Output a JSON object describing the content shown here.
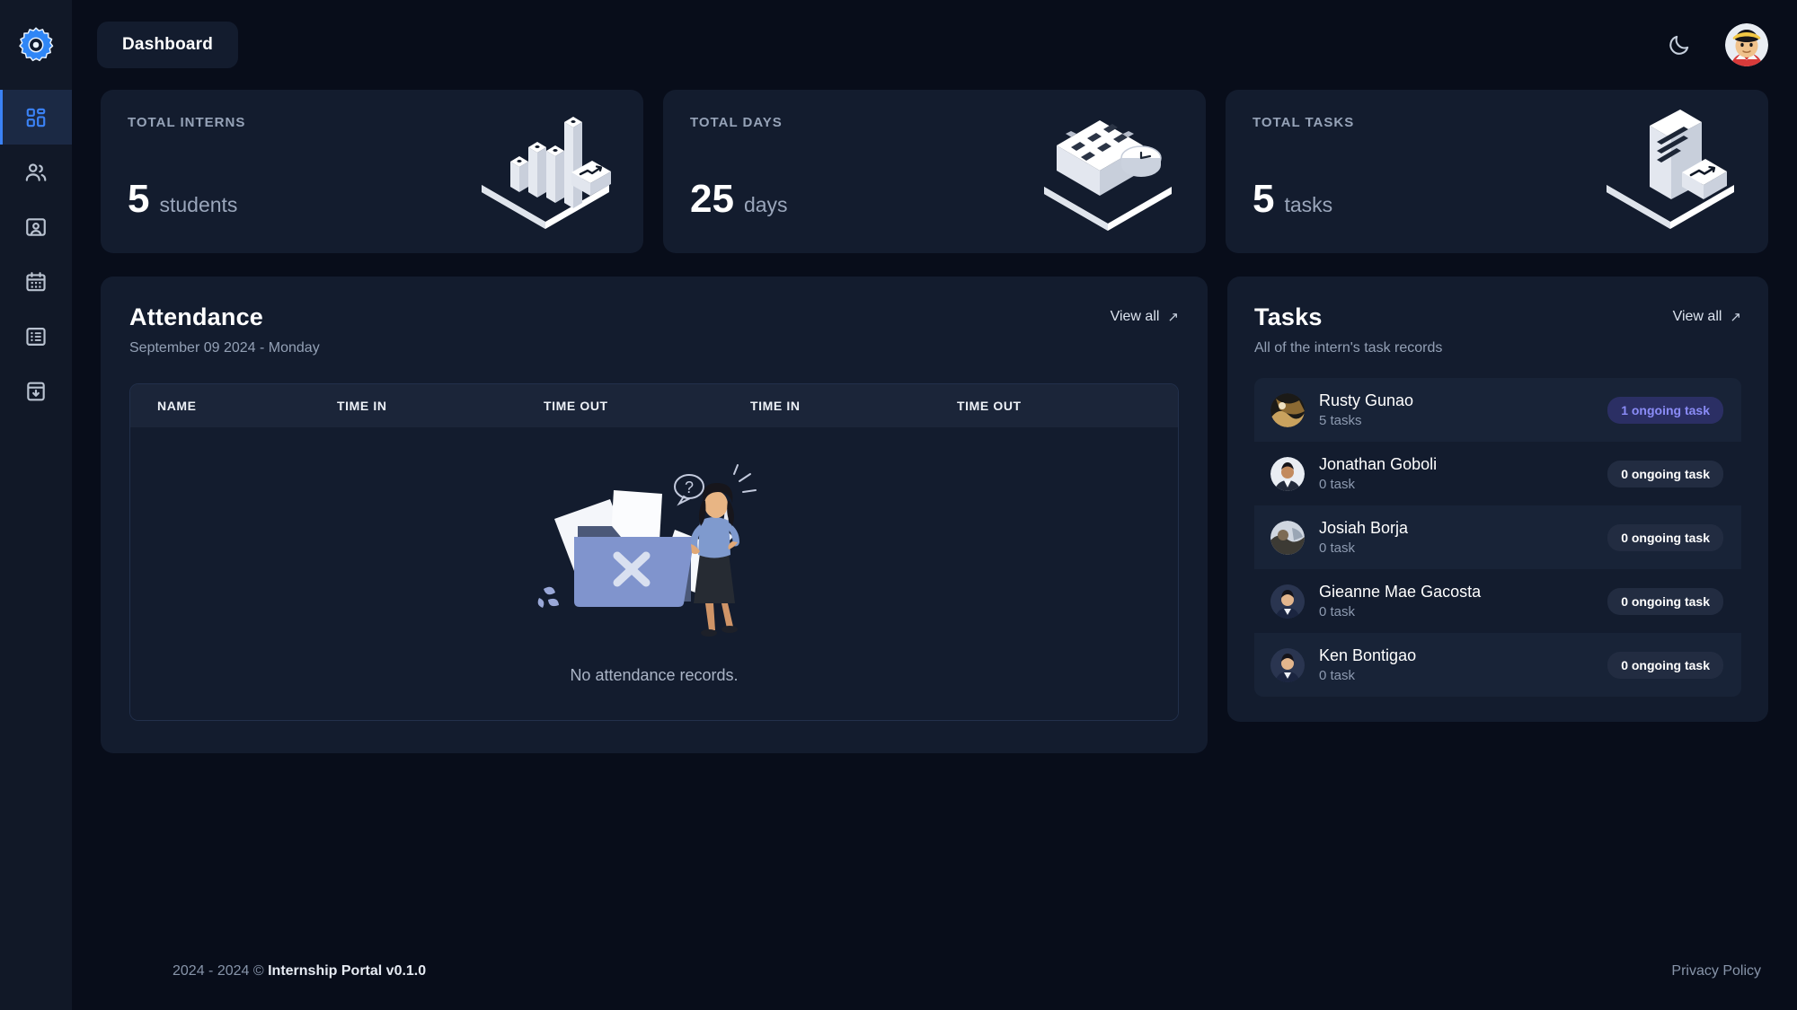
{
  "sidebar": {
    "logo_icon": "gear-icon",
    "items": [
      {
        "icon": "dashboard-grid-icon",
        "name": "dashboard",
        "active": true
      },
      {
        "icon": "users-icon",
        "name": "interns",
        "active": false
      },
      {
        "icon": "id-badge-icon",
        "name": "profiles",
        "active": false
      },
      {
        "icon": "calendar-icon",
        "name": "attendance",
        "active": false
      },
      {
        "icon": "list-icon",
        "name": "tasks",
        "active": false
      },
      {
        "icon": "archive-download-icon",
        "name": "reports",
        "active": false
      }
    ]
  },
  "topbar": {
    "page_title": "Dashboard",
    "theme_toggle_icon": "moon-icon",
    "avatar_icon": "user-avatar"
  },
  "stats": [
    {
      "label": "TOTAL INTERNS",
      "value": "5",
      "unit": "students",
      "art": "bar-chart-3d-icon"
    },
    {
      "label": "TOTAL DAYS",
      "value": "25",
      "unit": "days",
      "art": "calendar-clock-3d-icon"
    },
    {
      "label": "TOTAL TASKS",
      "value": "5",
      "unit": "tasks",
      "art": "document-3d-icon"
    }
  ],
  "attendance": {
    "title": "Attendance",
    "date": "September 09 2024 - Monday",
    "view_all": "View all",
    "columns": [
      "NAME",
      "TIME IN",
      "TIME OUT",
      "TIME IN",
      "TIME OUT"
    ],
    "rows": [],
    "empty_text": "No attendance records."
  },
  "tasks": {
    "title": "Tasks",
    "subtitle": "All of the intern's task records",
    "view_all": "View all",
    "rows": [
      {
        "name": "Rusty Gunao",
        "count": "5 tasks",
        "badge": "1 ongoing task",
        "active": true
      },
      {
        "name": "Jonathan Goboli",
        "count": "0 task",
        "badge": "0 ongoing task",
        "active": false
      },
      {
        "name": "Josiah Borja",
        "count": "0 task",
        "badge": "0 ongoing task",
        "active": false
      },
      {
        "name": "Gieanne Mae Gacosta",
        "count": "0 task",
        "badge": "0 ongoing task",
        "active": false
      },
      {
        "name": "Ken Bontigao",
        "count": "0 task",
        "badge": "0 ongoing task",
        "active": false
      }
    ]
  },
  "footer": {
    "copyright_years": "2024 - 2024 © ",
    "app_name": "Internship Portal v0.1.0",
    "privacy": "Privacy Policy"
  },
  "colors": {
    "accent": "#3b82f6",
    "badge_active_text": "#8b8cf7",
    "badge_active_bg": "#2b2f64",
    "panel_bg": "#131c2e",
    "page_bg": "#080d1a",
    "sidebar_bg": "#111827"
  }
}
